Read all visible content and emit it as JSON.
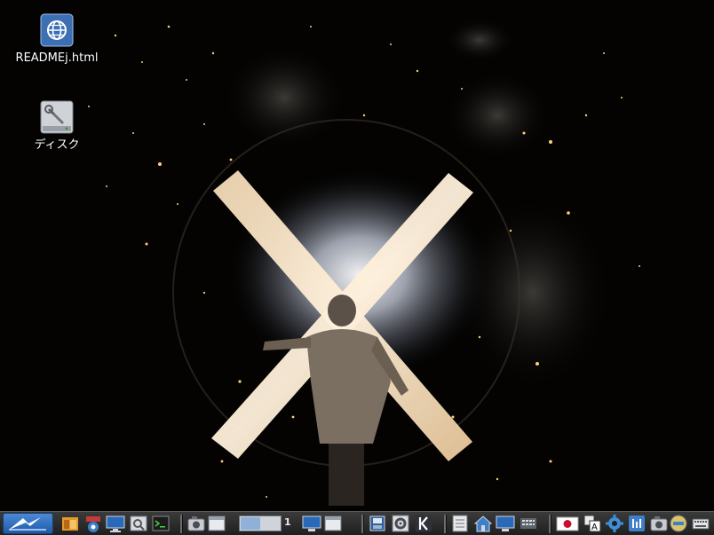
{
  "desktop": {
    "icons": [
      {
        "label": "READMEj.html",
        "icon": "globe-html-icon"
      },
      {
        "label": "ディスク",
        "icon": "disk-tool-icon"
      }
    ]
  },
  "taskbar": {
    "menu_icon": "lxde-menu-icon",
    "launchers": [
      "file-manager-icon",
      "network-icon",
      "desktop-icon",
      "image-viewer-icon",
      "terminal-icon"
    ],
    "launchers2": [
      "screenshot-icon",
      "window-icon"
    ],
    "workspace_number": "1",
    "launchers3": [
      "monitor-icon",
      "window-icon"
    ],
    "launchers4": [
      "disk-icon",
      "settings-icon",
      "kdeconnect-icon"
    ],
    "launchers5": [
      "document-icon",
      "home-icon",
      "display-icon",
      "keyboard-grid-icon"
    ],
    "tray": [
      "japan-flag-icon",
      "input-method-icon",
      "gear-icon",
      "network-status-icon",
      "camera-icon",
      "power-icon",
      "keyboard-icon"
    ]
  },
  "colors": {
    "accent": "#2f6fc0",
    "taskbar": "#2a2a2a"
  }
}
